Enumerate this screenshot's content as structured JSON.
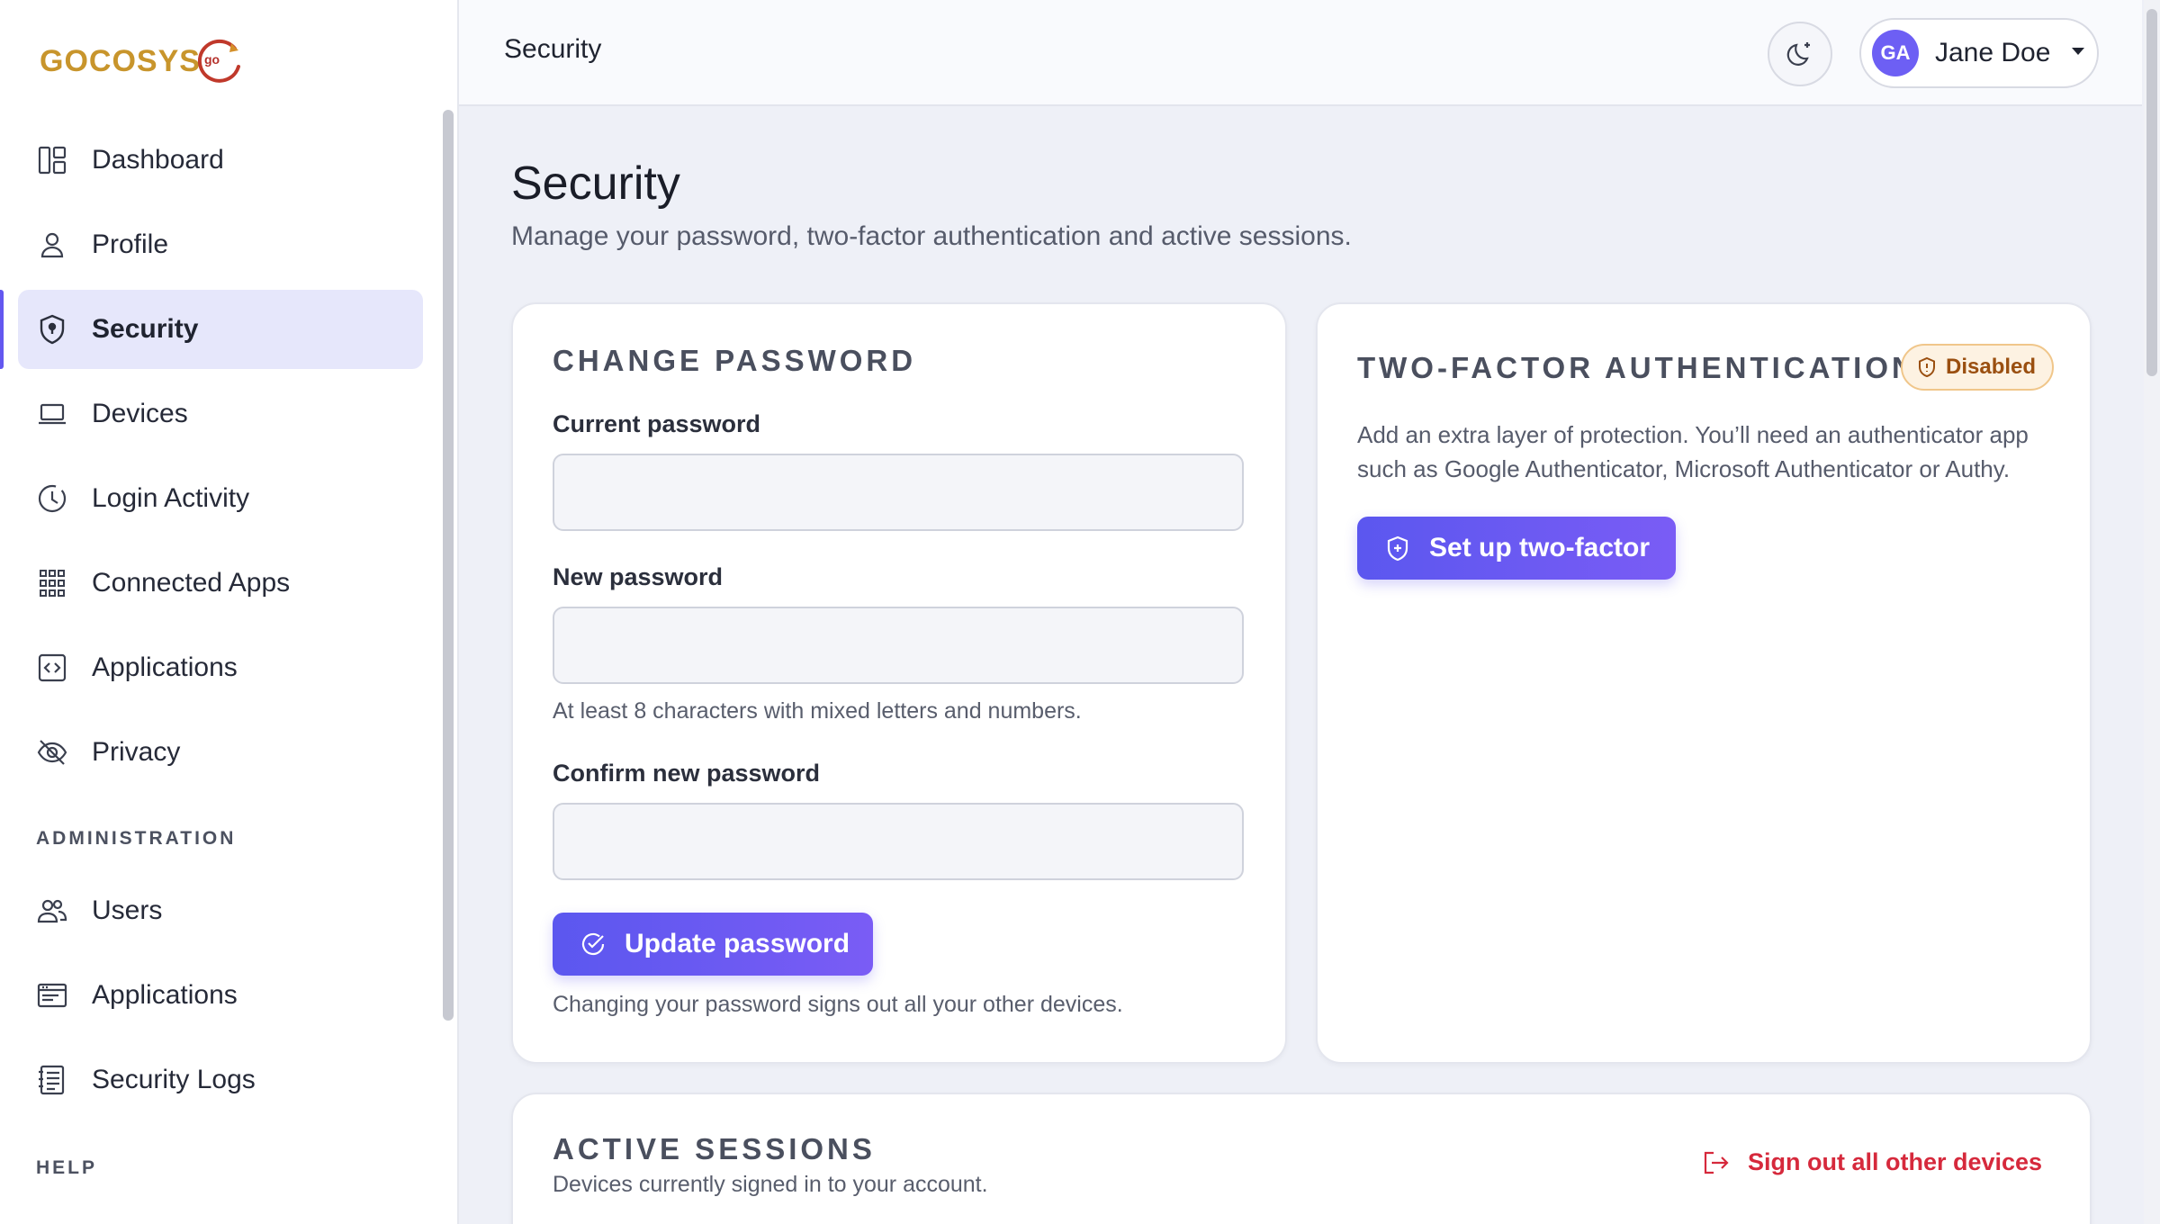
{
  "brand": {
    "name": "GOCOSYS",
    "mark": "go"
  },
  "sidebar": {
    "items": [
      {
        "label": "Dashboard",
        "icon": "dashboard-icon"
      },
      {
        "label": "Profile",
        "icon": "user-icon"
      },
      {
        "label": "Security",
        "icon": "shield-icon",
        "active": true
      },
      {
        "label": "Devices",
        "icon": "laptop-icon"
      },
      {
        "label": "Login Activity",
        "icon": "clock-icon"
      },
      {
        "label": "Connected Apps",
        "icon": "grid-icon"
      },
      {
        "label": "Applications",
        "icon": "code-icon"
      },
      {
        "label": "Privacy",
        "icon": "eye-off-icon"
      }
    ],
    "admin_section": "ADMINISTRATION",
    "admin_items": [
      {
        "label": "Users",
        "icon": "users-icon"
      },
      {
        "label": "Applications",
        "icon": "window-icon"
      },
      {
        "label": "Security Logs",
        "icon": "log-icon"
      }
    ],
    "help_section": "HELP"
  },
  "header": {
    "title": "Security",
    "theme_toggle_icon": "moon-star-icon",
    "user": {
      "initials": "GA",
      "name": "Jane Doe"
    }
  },
  "main": {
    "title": "Security",
    "subtitle": "Manage your password, two-factor authentication and active sessions.",
    "change_password": {
      "heading": "CHANGE PASSWORD",
      "current_label": "Current password",
      "current_value": "",
      "new_label": "New password",
      "new_value": "",
      "new_helper": "At least 8 characters with mixed letters and numbers.",
      "confirm_label": "Confirm new password",
      "confirm_value": "",
      "submit_label": "Update password",
      "footnote": "Changing your password signs out all your other devices."
    },
    "two_factor": {
      "heading": "TWO-FACTOR AUTHENTICATION",
      "status": "Disabled",
      "description": "Add an extra layer of protection. You’ll need an authenticator app such as Google Authenticator, Microsoft Authenticator or Authy.",
      "setup_label": "Set up two-factor"
    },
    "sessions": {
      "heading": "ACTIVE SESSIONS",
      "subtitle": "Devices currently signed in to your account.",
      "sign_out_all_label": "Sign out all other devices"
    }
  },
  "colors": {
    "accent": "#6357f0",
    "danger": "#d6293c",
    "badge_warning": "#9a4f10",
    "active_nav_bg": "#e6e7fb"
  }
}
